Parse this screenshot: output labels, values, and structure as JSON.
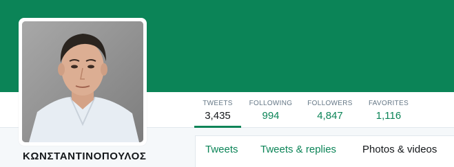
{
  "profile": {
    "name": "ΚΩΝΣΤΑΝΤΙΝΟΠΟΥΛΟΣ"
  },
  "stats": [
    {
      "label": "TWEETS",
      "value": "3,435",
      "active": true
    },
    {
      "label": "FOLLOWING",
      "value": "994",
      "active": false
    },
    {
      "label": "FOLLOWERS",
      "value": "4,847",
      "active": false
    },
    {
      "label": "FAVORITES",
      "value": "1,116",
      "active": false
    }
  ],
  "tabs": [
    {
      "label": "Tweets"
    },
    {
      "label": "Tweets & replies"
    },
    {
      "label": "Photos & videos"
    }
  ],
  "colors": {
    "brand": "#0b8457",
    "text": "#14171a",
    "muted": "#657786"
  }
}
